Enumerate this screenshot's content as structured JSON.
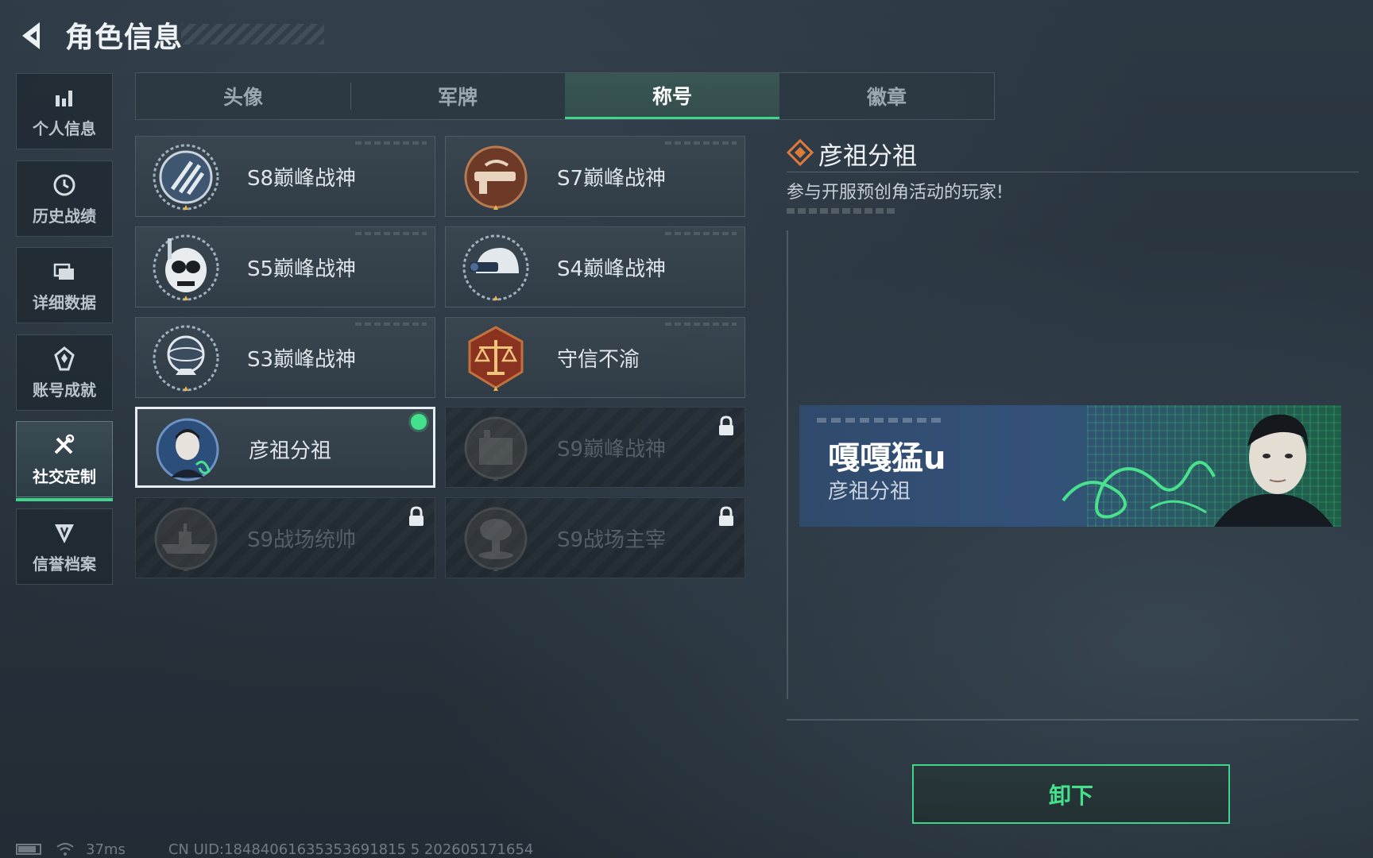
{
  "header": {
    "title": "角色信息"
  },
  "sidebar": {
    "items": [
      {
        "label": "个人信息",
        "icon": "bar-chart-icon",
        "active": false
      },
      {
        "label": "历史战绩",
        "icon": "clock-history-icon",
        "active": false
      },
      {
        "label": "详细数据",
        "icon": "folder-icon",
        "active": false
      },
      {
        "label": "账号成就",
        "icon": "achievement-medal-icon",
        "active": false
      },
      {
        "label": "社交定制",
        "icon": "tools-icon",
        "active": true
      },
      {
        "label": "信誉档案",
        "icon": "shield-badge-icon",
        "active": false
      }
    ]
  },
  "tabs": [
    {
      "label": "头像",
      "active": false
    },
    {
      "label": "军牌",
      "active": false
    },
    {
      "label": "称号",
      "active": true
    },
    {
      "label": "徽章",
      "active": false
    }
  ],
  "titles": [
    {
      "label": "S8巅峰战神",
      "state": "unlocked",
      "badge": "s8-emblem"
    },
    {
      "label": "S7巅峰战神",
      "state": "unlocked",
      "badge": "s7-emblem"
    },
    {
      "label": "S5巅峰战神",
      "state": "unlocked",
      "badge": "s5-emblem"
    },
    {
      "label": "S4巅峰战神",
      "state": "unlocked",
      "badge": "s4-emblem"
    },
    {
      "label": "S3巅峰战神",
      "state": "unlocked",
      "badge": "s3-emblem"
    },
    {
      "label": "守信不渝",
      "state": "unlocked",
      "badge": "scales-emblem"
    },
    {
      "label": "彦祖分祖",
      "state": "selected",
      "badge": "portrait-emblem"
    },
    {
      "label": "S9巅峰战神",
      "state": "locked",
      "badge": "s9-emblem"
    },
    {
      "label": "S9战场统帅",
      "state": "locked",
      "badge": "warship-emblem"
    },
    {
      "label": "S9战场主宰",
      "state": "locked",
      "badge": "mushroom-cloud-emblem"
    }
  ],
  "detail": {
    "title": "彦祖分祖",
    "description": "参与开服预创角活动的玩家!"
  },
  "banner": {
    "player_name": "嘎嘎猛u",
    "title": "彦祖分祖"
  },
  "actions": {
    "unequip_label": "卸下"
  },
  "status": {
    "ping": "37ms",
    "uid_text": "CN UID:18484061635353691815 5 202605171654"
  },
  "colors": {
    "accent_green": "#3fd48a",
    "detail_icon_orange": "#e07a3a",
    "background": "#27323c"
  }
}
